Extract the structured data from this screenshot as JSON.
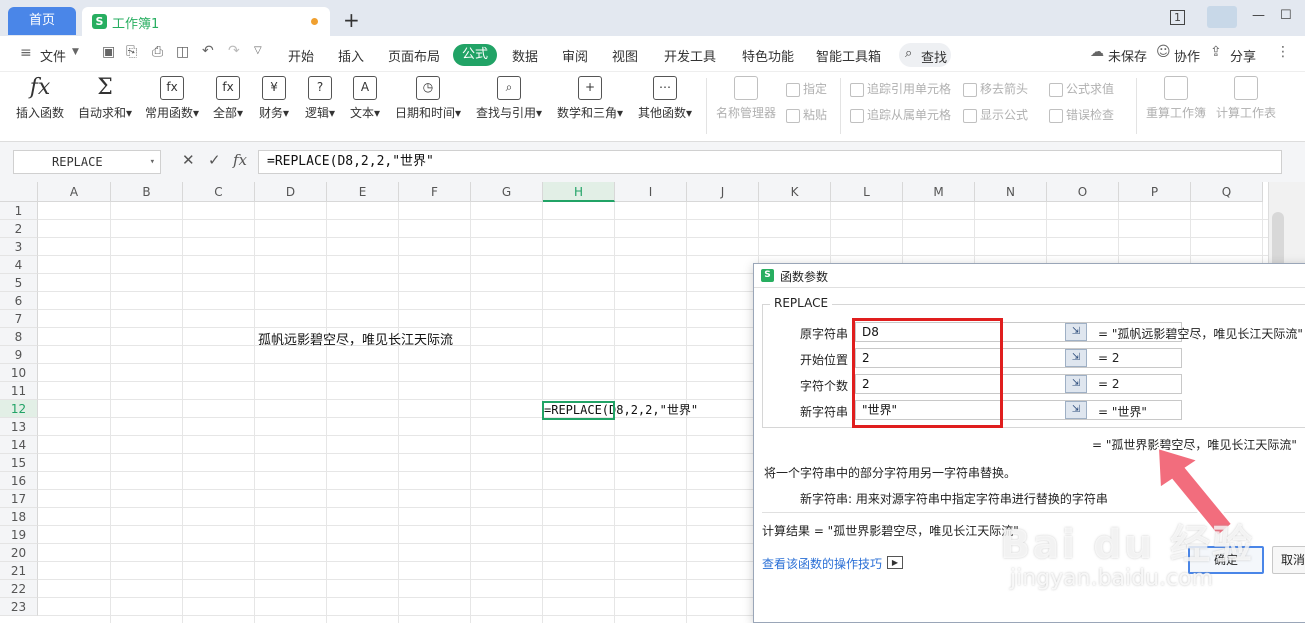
{
  "titlebar": {
    "home_tab": "首页",
    "doc_tab": "工作簿1",
    "new_tab": "+",
    "page_indicator": "1",
    "minimize": "—",
    "maximize": "☐"
  },
  "menubar": {
    "file": "文件",
    "items": [
      "开始",
      "插入",
      "页面布局",
      "公式",
      "数据",
      "审阅",
      "视图",
      "开发工具",
      "特色功能",
      "智能工具箱"
    ],
    "search": "查找",
    "unsaved": "未保存",
    "collab": "协作",
    "share": "分享"
  },
  "ribbon": {
    "insert_fn": "插入函数",
    "autosum": "自动求和",
    "common_fn": "常用函数",
    "all": "全部",
    "finance": "财务",
    "logic": "逻辑",
    "text": "文本",
    "datetime": "日期和时间",
    "lookup": "查找与引用",
    "math": "数学和三角",
    "other": "其他函数",
    "name_mgr": "名称管理器",
    "define": "指定",
    "paste": "粘贴",
    "trace_prec": "追踪引用单元格",
    "trace_dep": "追踪从属单元格",
    "remove_arrows": "移去箭头",
    "show_formula": "显示公式",
    "eval_formula": "公式求值",
    "error_check": "错误检查",
    "recalc_wb": "重算工作簿",
    "calc_sheet": "计算工作表"
  },
  "formula_bar": {
    "name_box": "REPLACE",
    "formula": "=REPLACE(D8,2,2,\"世界\""
  },
  "grid": {
    "columns": [
      "A",
      "B",
      "C",
      "D",
      "E",
      "F",
      "G",
      "H",
      "I",
      "J",
      "K",
      "L",
      "M",
      "N",
      "O",
      "P",
      "Q"
    ],
    "rows": [
      "1",
      "2",
      "3",
      "4",
      "5",
      "6",
      "7",
      "8",
      "9",
      "10",
      "11",
      "12",
      "13",
      "14",
      "15",
      "16",
      "17",
      "18",
      "19",
      "20",
      "21",
      "22",
      "23"
    ],
    "d8": "孤帆远影碧空尽，唯见长江天际流",
    "h12": "=REPLACE(D8,2,2,\"世界\""
  },
  "dialog": {
    "title": "函数参数",
    "fn_name": "REPLACE",
    "args": [
      {
        "label": "原字符串",
        "value": "D8",
        "result": "= \"孤帆远影碧空尽，唯见长江天际流\""
      },
      {
        "label": "开始位置",
        "value": "2",
        "result": "= 2"
      },
      {
        "label": "字符个数",
        "value": "2",
        "result": "= 2"
      },
      {
        "label": "新字符串",
        "value": "\"世界\"",
        "result": "= \"世界\""
      }
    ],
    "fn_result": "= \"孤世界影碧空尽，唯见长江天际流\"",
    "description": "将一个字符串中的部分字符用另一字符串替换。",
    "arg_desc": "新字符串:   用来对源字符串中指定字符串进行替换的字符串",
    "calc_result": "计算结果 =  \"孤世界影碧空尽，唯见长江天际流\"",
    "help_link": "查看该函数的操作技巧",
    "ok": "确定",
    "cancel": "取消"
  },
  "watermark": {
    "brand": "Bai du 经验",
    "url": "jingyan.baidu.com"
  },
  "colors": {
    "accent": "#21a366",
    "highlight": "#e01e1e",
    "tab_blue": "#4a86e8"
  }
}
